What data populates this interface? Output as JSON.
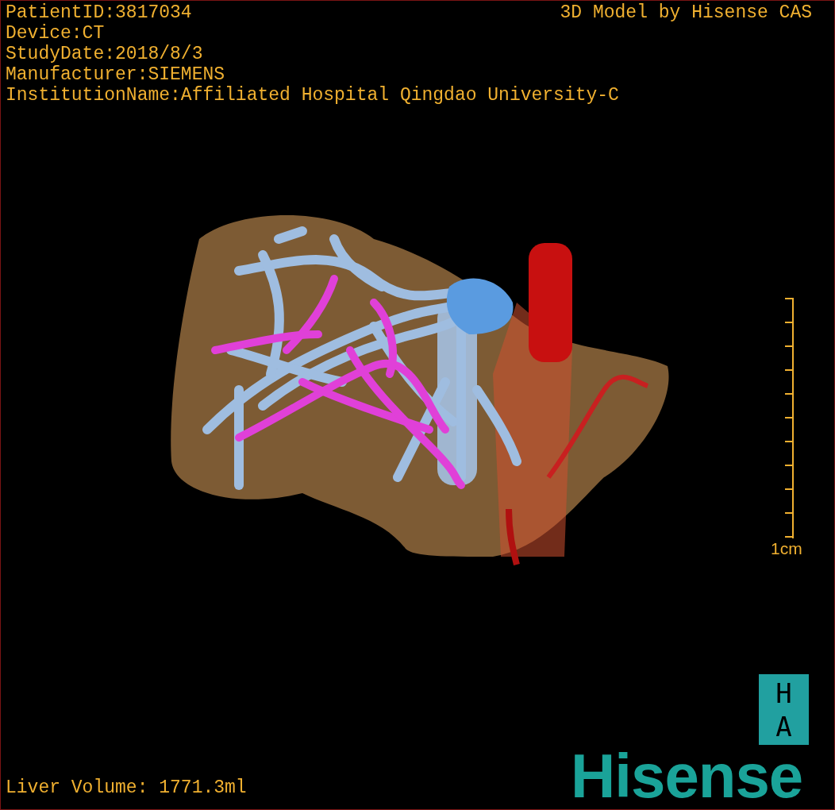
{
  "viewport": {
    "patient_info": [
      "PatientID:3817034",
      "Device:CT",
      "StudyDate:2018/8/3",
      "Manufacturer:SIEMENS",
      "InstitutionName:Affiliated Hospital Qingdao University-C"
    ],
    "model_credit": "3D Model by Hisense CAS",
    "scale_bar": {
      "label": "1cm"
    },
    "orientation": [
      "H",
      "A"
    ],
    "logo": "Hisense",
    "volume": "Liver Volume: 1771.3ml"
  }
}
